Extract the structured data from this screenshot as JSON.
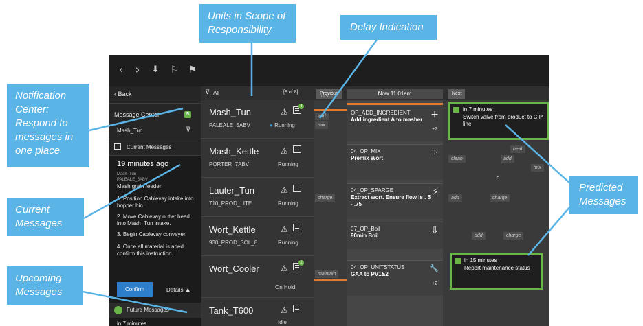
{
  "callouts": {
    "units_scope": [
      "Units in Scope of",
      "Responsibility"
    ],
    "delay": [
      "Delay Indication"
    ],
    "notification": [
      "Notification",
      "Center:",
      "Respond to",
      "messages in",
      "one place"
    ],
    "current": [
      "Current",
      "Messages"
    ],
    "upcoming": [
      "Upcoming",
      "Messages"
    ],
    "predicted": [
      "Predicted",
      "Messages"
    ]
  },
  "topbar": {
    "icons": [
      "chevron-left-icon",
      "chevron-right-icon",
      "inbox-down-icon",
      "flag-icon",
      "flag-alert-icon"
    ],
    "glyphs": [
      "‹",
      "›",
      "⬇",
      "⚐",
      "⚑"
    ]
  },
  "left_panel": {
    "back_label": "Back",
    "message_center_label": "Message Center",
    "message_center_badge": "5",
    "filter_unit": "Mash_Tun",
    "current_messages_label": "Current Messages",
    "current_time": "19 minutes ago",
    "current_meta": [
      "Mash_Tun",
      "PALEALE_5ABV",
      "Mash grain feeder"
    ],
    "instructions": [
      "1. Position Cablevay intake into hopper bin.",
      "2. Move Cablevay outlet head into Mash_Tun intake.",
      "3. Begin Cablevay conveyer.",
      "4. Once all material is aded confirm this instruction."
    ],
    "confirm_label": "Confirm",
    "details_label": "Details",
    "future_messages_label": "Future Messages",
    "future_time": "in 7 minutes"
  },
  "units_header": {
    "filter_label": "All",
    "count": "[8 of 8]"
  },
  "units": [
    {
      "name": "Mash_Tun",
      "product": "PALEALE_5ABV",
      "status": "Running",
      "badge": "4"
    },
    {
      "name": "Mash_Kettle",
      "product": "PORTER_7ABV",
      "status": "Running",
      "badge": ""
    },
    {
      "name": "Lauter_Tun",
      "product": "710_PROD_LITE",
      "status": "Running",
      "badge": ""
    },
    {
      "name": "Wort_Kettle",
      "product": "930_PROD_SOL_8",
      "status": "Running",
      "badge": ""
    },
    {
      "name": "Wort_Cooler",
      "product": "",
      "status": "On Hold",
      "badge": "2"
    },
    {
      "name": "Tank_T600",
      "product": "",
      "status": "Idle",
      "badge": ""
    }
  ],
  "timeline": {
    "previous_label": "Previous",
    "previous_time": "10:30",
    "now_label": "Now  11:01am",
    "next_label": "Next",
    "cards": [
      {
        "code": "OP_ADD_INGREDIENT",
        "desc": "Add ingredient A to masher",
        "action": "+"
      },
      {
        "code": "04_OP_MIX",
        "desc": "Premix Wort",
        "action": "⁘"
      },
      {
        "code": "04_OP_SPARGE",
        "desc": "Extract wort. Ensure flow is . 5 - .75",
        "action": "⚡"
      },
      {
        "code": "07_OP_Boil",
        "desc": "90min Boil",
        "action": "⇩"
      },
      {
        "code": "04_OP_UNITSTATUS",
        "desc": "GAA to PV1&2",
        "action": "🔧"
      }
    ],
    "chips": {
      "add": "add",
      "mix": "mix",
      "clean": "clean",
      "heat": "heat",
      "charge": "charge",
      "maintain": "maintain"
    },
    "counts": [
      "+7",
      "+2"
    ],
    "predicted": [
      {
        "time": "in 7 minutes",
        "text": "Switch valve from product to CIP line"
      },
      {
        "time": "in 15 minutes",
        "text": "Report maintenance status"
      }
    ]
  }
}
